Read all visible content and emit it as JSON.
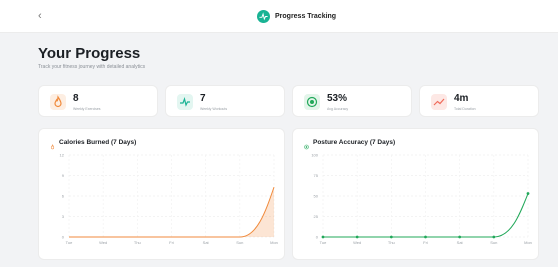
{
  "header": {
    "back_icon": "chevron-left-icon",
    "title": "Progress Tracking",
    "brand_icon": "pulse-icon",
    "brand_color": "#19b394"
  },
  "page": {
    "title": "Your Progress",
    "subtitle": "Track your fitness journey with detailed analytics"
  },
  "stats": [
    {
      "value": "8",
      "label": "Weekly Exercises",
      "icon": "flame-icon",
      "color": "#f08a3c",
      "bg": "#fdeee2"
    },
    {
      "value": "7",
      "label": "Weekly Workouts",
      "icon": "pulse-icon",
      "color": "#19b394",
      "bg": "#e3f6f1"
    },
    {
      "value": "53%",
      "label": "Avg Accuracy",
      "icon": "target-icon",
      "color": "#22a85a",
      "bg": "#e3f5ea"
    },
    {
      "value": "4m",
      "label": "Total Duration",
      "icon": "trend-up-icon",
      "color": "#f06a5a",
      "bg": "#fde8e5"
    }
  ],
  "chart_data": [
    {
      "type": "area",
      "title": "Calories Burned (7 Days)",
      "icon": "flame-icon",
      "color": "#f08a3c",
      "categories": [
        "Tue",
        "Wed",
        "Thu",
        "Fri",
        "Sat",
        "Sun",
        "Mon"
      ],
      "values": [
        0,
        0,
        0,
        0,
        0,
        0,
        7.3
      ],
      "ylim": [
        0,
        12
      ],
      "yticks": [
        "0",
        "3",
        "6",
        "9",
        "12"
      ],
      "grid": true
    },
    {
      "type": "line",
      "title": "Posture Accuracy (7 Days)",
      "icon": "target-icon",
      "color": "#22a85a",
      "categories": [
        "Tue",
        "Wed",
        "Thu",
        "Fri",
        "Sat",
        "Sun",
        "Mon"
      ],
      "values": [
        0,
        0,
        0,
        0,
        0,
        0,
        53
      ],
      "ylim": [
        0,
        100
      ],
      "yticks": [
        "0",
        "25",
        "50",
        "75",
        "100"
      ],
      "grid": true
    }
  ]
}
